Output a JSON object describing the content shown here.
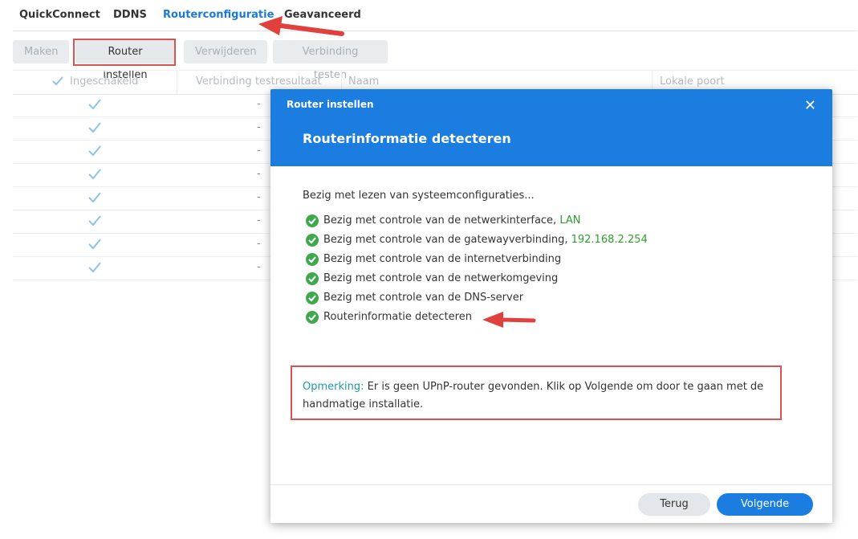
{
  "tabs": [
    "QuickConnect",
    "DDNS",
    "Routerconfiguratie",
    "Geavanceerd"
  ],
  "active_tab": "Routerconfiguratie",
  "toolbar": {
    "create": "Maken",
    "router_setup": "Router instellen",
    "delete": "Verwijderen",
    "test_connection": "Verbinding testen"
  },
  "table": {
    "headers": {
      "enabled": "Ingeschakeld",
      "test_result": "Verbinding testresultaat",
      "name": "Naam",
      "local_port": "Lokale poort"
    },
    "rows": [
      "-",
      "-",
      "-",
      "-",
      "-",
      "-",
      "-",
      "-"
    ]
  },
  "dialog": {
    "title": "Router instellen",
    "close": "✕",
    "subtitle": "Routerinformatie detecteren",
    "intro": "Bezig met lezen van systeemconfiguraties...",
    "checks": [
      {
        "text": "Bezig met controle van de netwerkinterface, ",
        "value": "LAN"
      },
      {
        "text": "Bezig met controle van de gatewayverbinding, ",
        "value": "192.168.2.254"
      },
      {
        "text": "Bezig met controle van de internetverbinding",
        "value": ""
      },
      {
        "text": "Bezig met controle van de netwerkomgeving",
        "value": ""
      },
      {
        "text": "Bezig met controle van de DNS-server",
        "value": ""
      },
      {
        "text": "Routerinformatie detecteren",
        "value": ""
      }
    ],
    "note_label": "Opmerking:",
    "note_text": " Er is geen UPnP-router gevonden. Klik op Volgende om door te gaan met de handmatige installatie.",
    "back": "Terug",
    "next": "Volgende"
  },
  "colors": {
    "accent": "#1b7de0",
    "success": "#3fa84c",
    "annotation": "#d9534f"
  }
}
